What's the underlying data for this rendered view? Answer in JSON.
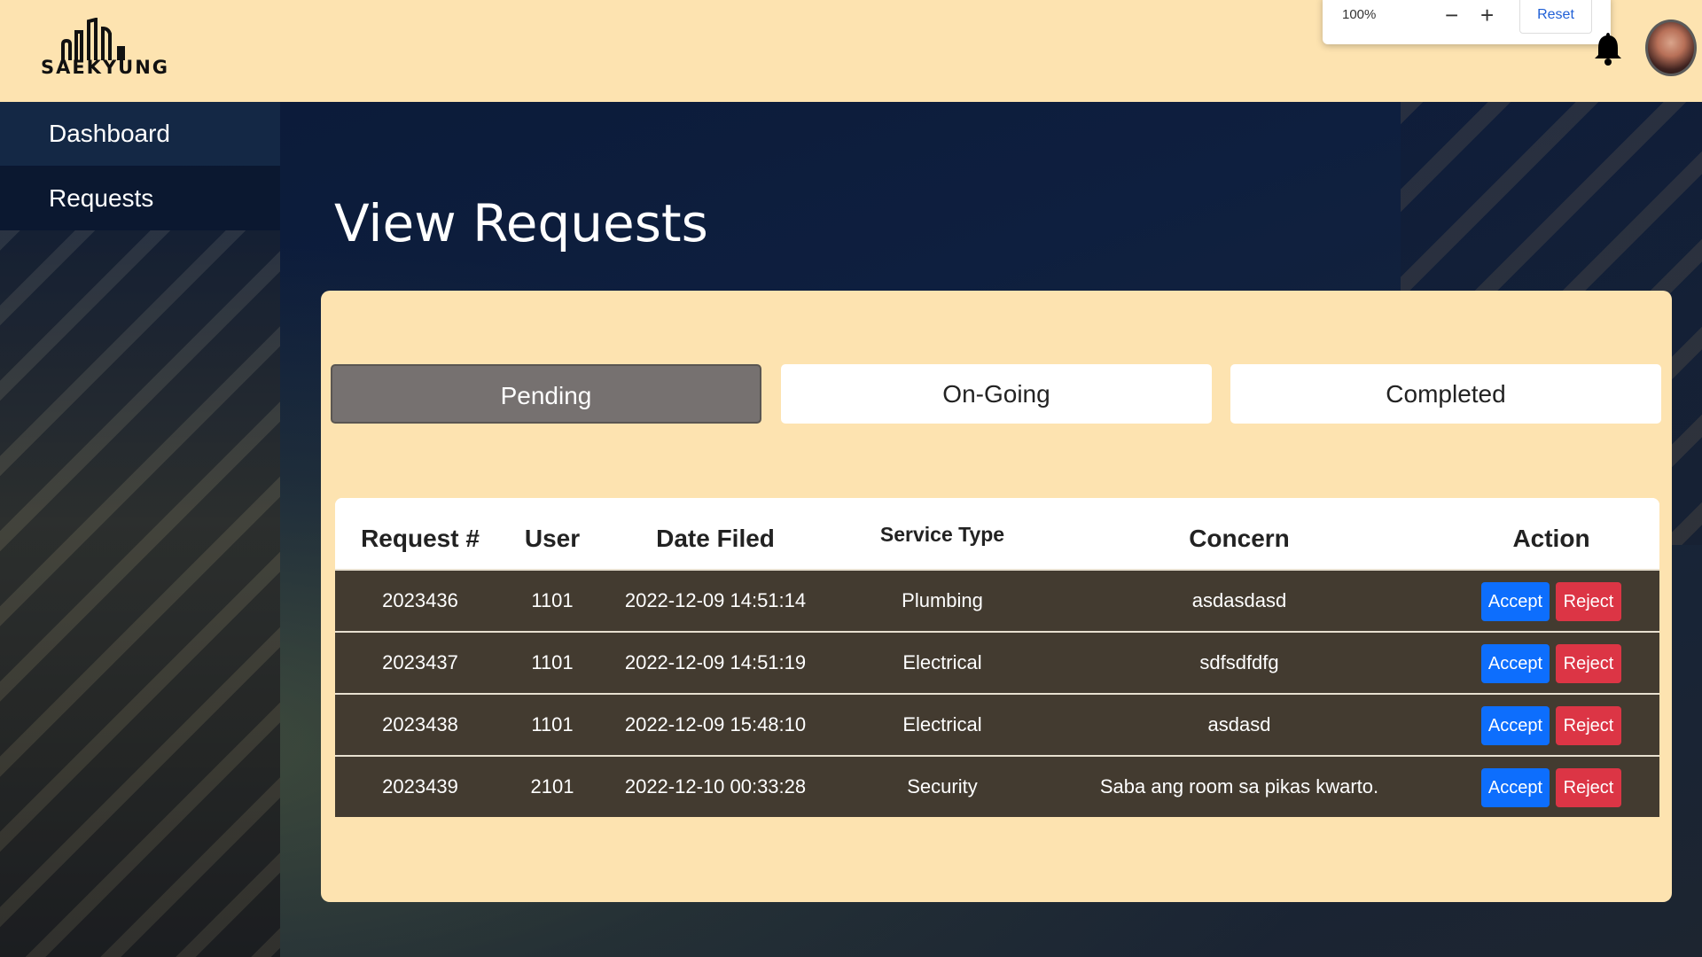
{
  "header": {
    "logo_text": "SAEKYUNG",
    "zoom": {
      "level": "100%",
      "zoom_out": "−",
      "zoom_in": "+",
      "reset": "Reset"
    }
  },
  "sidebar": {
    "items": [
      {
        "label": "Dashboard"
      },
      {
        "label": "Requests"
      }
    ]
  },
  "main": {
    "title": "View Requests",
    "tabs": [
      {
        "label": "Pending",
        "active": true
      },
      {
        "label": "On-Going",
        "active": false
      },
      {
        "label": "Completed",
        "active": false
      }
    ],
    "table": {
      "columns": [
        "Request #",
        "User",
        "Date Filed",
        "Service Type",
        "Concern",
        "Action"
      ],
      "rows": [
        {
          "request": "2023436",
          "user": "1101",
          "date": "2022-12-09 14:51:14",
          "service": "Plumbing",
          "concern": "asdasdasd",
          "accept": "Accept",
          "reject": "Reject"
        },
        {
          "request": "2023437",
          "user": "1101",
          "date": "2022-12-09 14:51:19",
          "service": "Electrical",
          "concern": "sdfsdfdfg",
          "accept": "Accept",
          "reject": "Reject"
        },
        {
          "request": "2023438",
          "user": "1101",
          "date": "2022-12-09 15:48:10",
          "service": "Electrical",
          "concern": "asdasd",
          "accept": "Accept",
          "reject": "Reject"
        },
        {
          "request": "2023439",
          "user": "2101",
          "date": "2022-12-10 00:33:28",
          "service": "Security",
          "concern": "Saba ang room sa pikas kwarto.",
          "accept": "Accept",
          "reject": "Reject"
        }
      ]
    }
  },
  "colors": {
    "header_bg": "#fde3b0",
    "panel_bg": "#fde3b0",
    "active_tab": "#767170",
    "row_bg": "#433b30",
    "accept": "#0d6efd",
    "reject": "#dc3545"
  }
}
